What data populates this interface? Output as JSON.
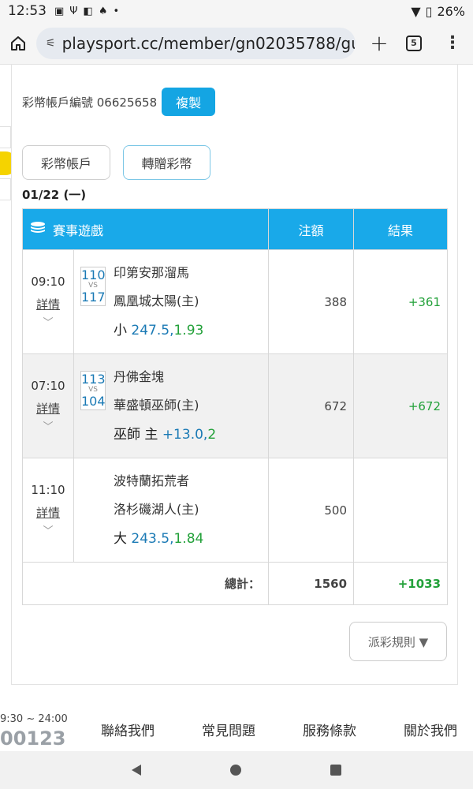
{
  "status": {
    "time": "12:53",
    "battery": "26%"
  },
  "browser": {
    "url": "playsport.cc/member/gn02035788/gu",
    "tab_count": "5"
  },
  "account": {
    "label": "彩幣帳戶編號 06625658",
    "copy_label": "複製"
  },
  "tabs": [
    {
      "label": "彩幣帳戶"
    },
    {
      "label": "轉贈彩幣"
    }
  ],
  "date": "01/22 (一)",
  "table": {
    "headers": {
      "game": "賽事遊戲",
      "amount": "注額",
      "result": "結果"
    },
    "rows": [
      {
        "time": "09:10",
        "detail": "詳情",
        "score_a": "110",
        "score_b": "117",
        "vs": "VS",
        "team_a": "印第安那溜馬",
        "team_b": "鳳凰城太陽(主)",
        "pick_label": "小",
        "pick_line": "247.5,",
        "pick_odds": "1.93",
        "amount": "388",
        "result": "+361"
      },
      {
        "time": "07:10",
        "detail": "詳情",
        "score_a": "113",
        "score_b": "104",
        "vs": "VS",
        "team_a": "丹佛金塊",
        "team_b": "華盛頓巫師(主)",
        "pick_label": "巫師 主",
        "pick_line": "+13.0,",
        "pick_odds": "2",
        "amount": "672",
        "result": "+672"
      },
      {
        "time": "11:10",
        "detail": "詳情",
        "team_a": "波特蘭拓荒者",
        "team_b": "洛杉磯湖人(主)",
        "pick_label": "大",
        "pick_line": "243.5,",
        "pick_odds": "1.84",
        "amount": "500",
        "result": ""
      }
    ],
    "total": {
      "label": "總計：",
      "amount": "1560",
      "result": "+1033"
    }
  },
  "rules_label": "派彩規則 ▼",
  "footer": {
    "hours": "9:30 ~ 24:00",
    "code": "00123",
    "links": [
      "聯絡我們",
      "常見問題",
      "服務條款",
      "關於我們"
    ]
  }
}
